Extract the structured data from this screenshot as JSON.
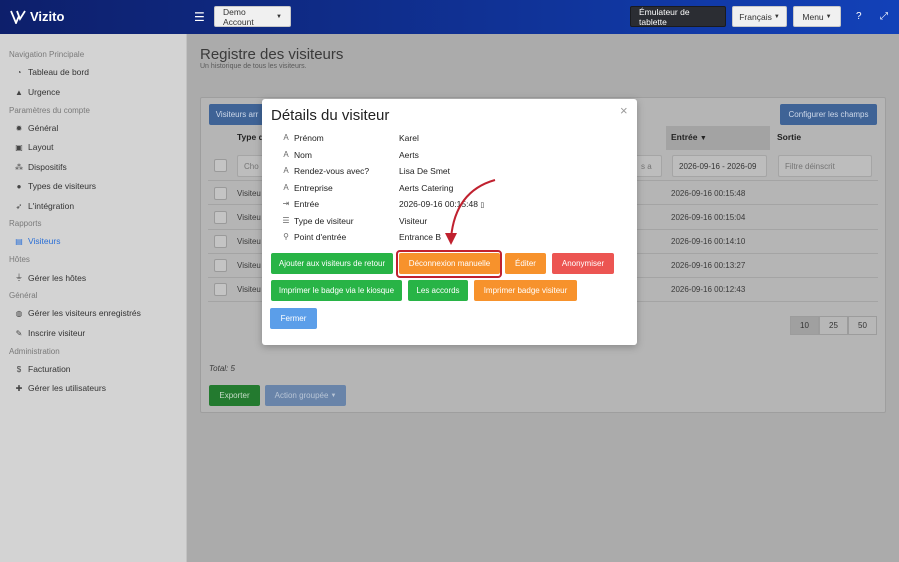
{
  "brand": {
    "name": "Vizito"
  },
  "topbar": {
    "account_label": "Demo Account",
    "tablet_label": "Émulateur de tablette",
    "language_label": "Français",
    "menu_label": "Menu",
    "help_icon": "question-icon",
    "fullscreen_icon": "expand-icon"
  },
  "sidebar": {
    "sections": [
      {
        "title": "Navigation Principale",
        "items": [
          {
            "label": "Tableau de bord",
            "icon": "dashboard-icon"
          },
          {
            "label": "Urgence",
            "icon": "warning-icon"
          }
        ]
      },
      {
        "title": "Paramètres du compte",
        "items": [
          {
            "label": "Général",
            "icon": "gear-icon"
          },
          {
            "label": "Layout",
            "icon": "image-icon"
          },
          {
            "label": "Dispositifs",
            "icon": "network-icon"
          },
          {
            "label": "Types de visiteurs",
            "icon": "users-icon"
          },
          {
            "label": "L'intégration",
            "icon": "rocket-icon"
          }
        ]
      },
      {
        "title": "Rapports",
        "items": [
          {
            "label": "Visiteurs",
            "icon": "book-icon",
            "active": true
          }
        ]
      },
      {
        "title": "Hôtes",
        "items": [
          {
            "label": "Gérer les hôtes",
            "icon": "plug-icon"
          }
        ]
      },
      {
        "title": "Général",
        "items": [
          {
            "label": "Gérer les visiteurs enregistrés",
            "icon": "globe-icon"
          },
          {
            "label": "Inscrire visiteur",
            "icon": "pencil-icon"
          }
        ]
      },
      {
        "title": "Administration",
        "items": [
          {
            "label": "Facturation",
            "icon": "dollar-icon"
          },
          {
            "label": "Gérer les utilisateurs",
            "icon": "user-plus-icon"
          }
        ]
      }
    ]
  },
  "page": {
    "title": "Registre des visiteurs",
    "subtitle": "Un historique de tous les visiteurs."
  },
  "table": {
    "visitors_button": "Visiteurs arr",
    "configure_button": "Configurer les champs",
    "headers": {
      "type": "Type d",
      "entree": "Entrée",
      "sortie": "Sortie"
    },
    "filters": {
      "type_placeholder": "Cho",
      "search_partial": "s a",
      "date_range": "2026-09-16 - 2026-09",
      "exit_placeholder": "Filtre déinscrit"
    },
    "rows": [
      {
        "type": "Visiteu",
        "entree": "2026-09-16 00:15:48"
      },
      {
        "type": "Visiteu",
        "entree": "2026-09-16 00:15:04"
      },
      {
        "type": "Visiteu",
        "entree": "2026-09-16 00:14:10"
      },
      {
        "type": "Visiteu",
        "entree": "2026-09-16 00:13:27"
      },
      {
        "type": "Visiteu",
        "entree": "2026-09-16 00:12:43"
      }
    ],
    "page_sizes": [
      "10",
      "25",
      "50"
    ],
    "total": "Total: 5",
    "export_button": "Exporter",
    "bulk_button": "Action groupée"
  },
  "modal": {
    "title": "Détails du visiteur",
    "close": "×",
    "details": [
      {
        "label": "Prénom",
        "value": "Karel",
        "icon": "font-icon"
      },
      {
        "label": "Nom",
        "value": "Aerts",
        "icon": "font-icon"
      },
      {
        "label": "Rendez-vous avec?",
        "value": "Lisa De Smet",
        "icon": "font-icon"
      },
      {
        "label": "Entreprise",
        "value": "Aerts Catering",
        "icon": "font-icon"
      },
      {
        "label": "Entrée",
        "value": "2026-09-16 00:15:48",
        "icon": "sign-in-icon"
      },
      {
        "label": "Type de visiteur",
        "value": "Visiteur",
        "icon": "list-icon"
      },
      {
        "label": "Point d'entrée",
        "value": "Entrance B",
        "icon": "location-icon"
      }
    ],
    "buttons": {
      "add_returning": "Ajouter aux visiteurs de retour",
      "manual_logout": "Déconnexion manuelle",
      "edit": "Éditer",
      "anonymize": "Anonymiser",
      "print_kiosk": "Imprimer le badge via le kiosque",
      "agreements": "Les accords",
      "print_badge": "Imprimer badge visiteur",
      "close": "Fermer"
    }
  },
  "colors": {
    "green": "#28b446",
    "orange": "#f7922c",
    "red": "#ec5552",
    "blue": "#5b9ee9",
    "highlight": "#c0212f"
  }
}
